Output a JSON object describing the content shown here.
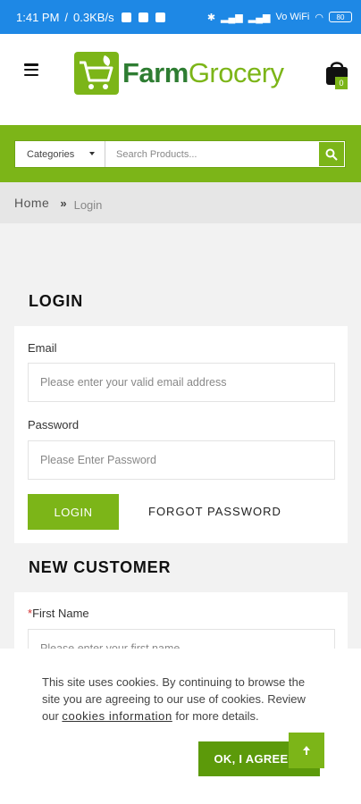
{
  "status_bar": {
    "time": "1:41 PM",
    "speed": "0.3KB/s",
    "network": "Vo WiFi",
    "battery": "80"
  },
  "header": {
    "logo_part1": "Farm",
    "logo_part2": "Grocery",
    "cart_count": "0"
  },
  "search": {
    "category_label": "Categories",
    "placeholder": "Search Products..."
  },
  "breadcrumb": {
    "home": "Home",
    "separator": "»",
    "current": "Login"
  },
  "login": {
    "title": "LOGIN",
    "email_label": "Email",
    "email_placeholder": "Please enter your valid email address",
    "password_label": "Password",
    "password_placeholder": "Please Enter Password",
    "login_button": "LOGIN",
    "forgot_link": "FORGOT PASSWORD"
  },
  "new_customer": {
    "title": "NEW CUSTOMER",
    "required_mark": "*",
    "first_name_label": "First Name",
    "first_name_placeholder": "Please enter your first name"
  },
  "cookie": {
    "text_before": "This site uses cookies. By continuing to browse the site you are agreeing to our use of cookies. Review our ",
    "link": "cookies information",
    "text_after": " for more details.",
    "agree_button": "OK, I AGREE"
  },
  "colors": {
    "brand_green": "#7cb518",
    "status_bar": "#1e88e5"
  }
}
